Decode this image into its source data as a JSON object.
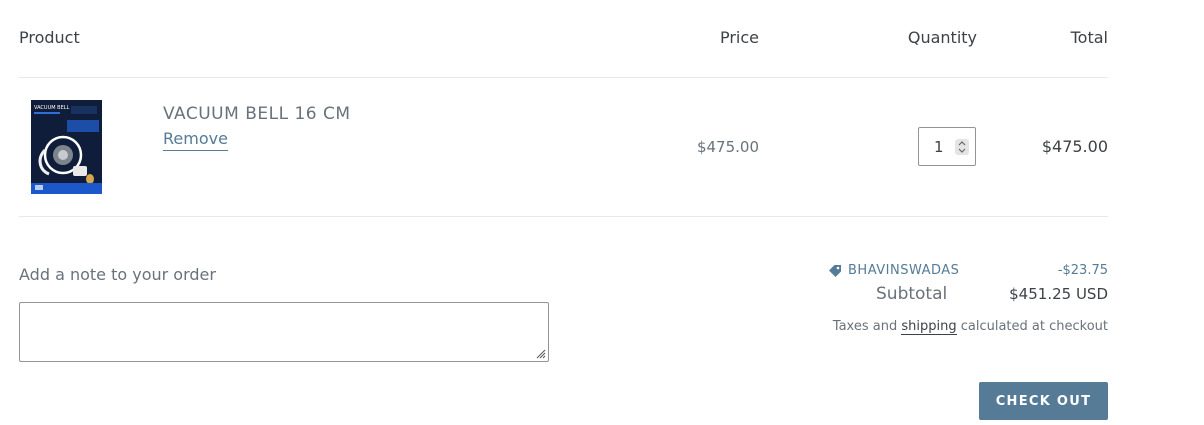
{
  "table_headers": {
    "product": "Product",
    "price": "Price",
    "quantity": "Quantity",
    "total": "Total"
  },
  "cart_item": {
    "title": "VACUUM BELL 16 CM",
    "remove_label": "Remove",
    "price": "$475.00",
    "quantity": "1",
    "line_total": "$475.00",
    "thumbnail_header": "VACUUM BELL"
  },
  "note": {
    "label": "Add a note to your order",
    "value": ""
  },
  "summary": {
    "discount_code": "BHAVINSWADAS",
    "discount_amount": "-$23.75",
    "subtotal_label": "Subtotal",
    "subtotal_value": "$451.25 USD",
    "tax_prefix": "Taxes and",
    "tax_link": "shipping",
    "tax_suffix": "calculated at checkout"
  },
  "checkout_label": "CHECK OUT",
  "colors": {
    "accent": "#557b97",
    "text": "#3d4246",
    "muted": "#69727b",
    "border": "#949494",
    "divider": "#e8e9eb"
  },
  "icons": {
    "discount": "tag-icon",
    "quantity_spinner": "spinner-arrows-icon",
    "resize": "resize-handle-icon"
  }
}
